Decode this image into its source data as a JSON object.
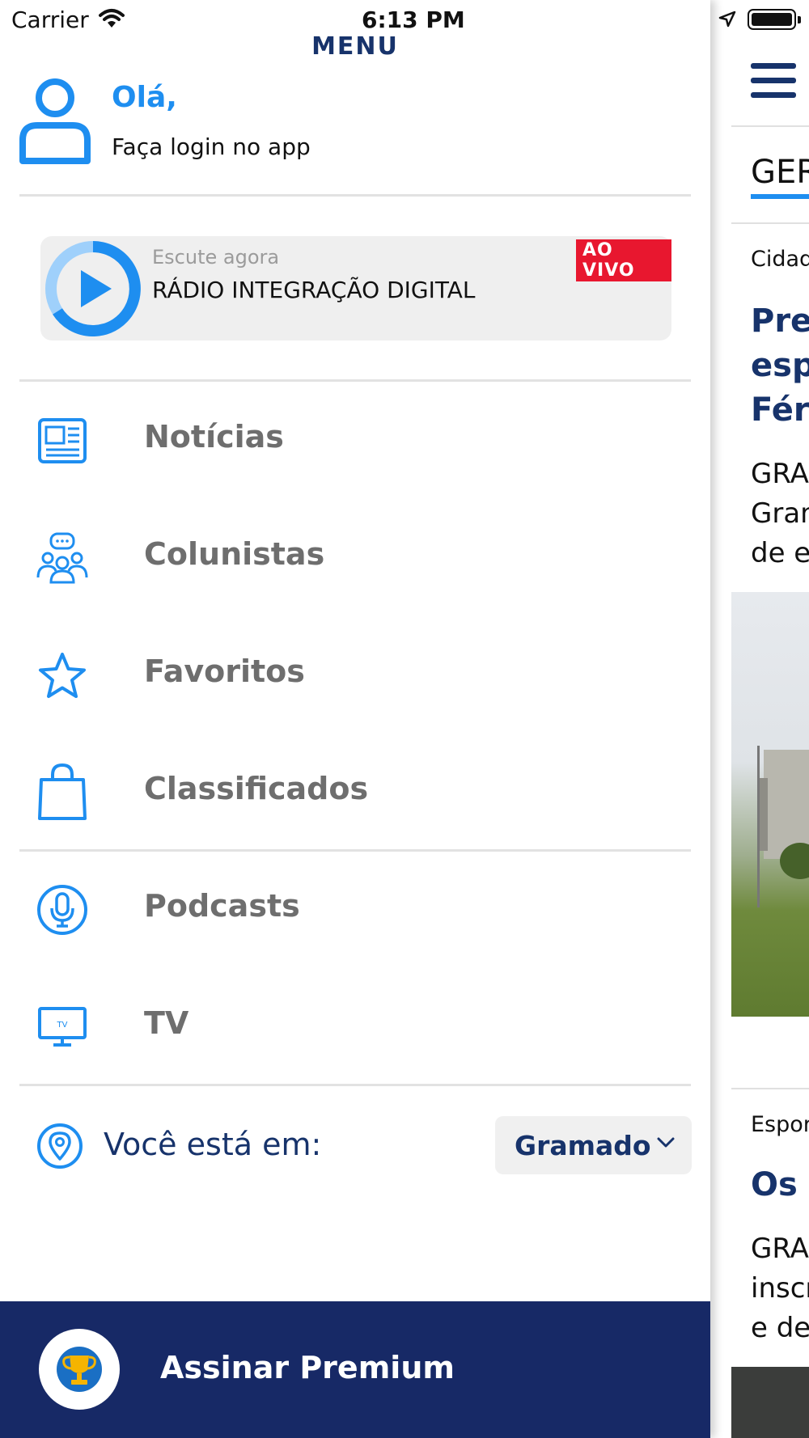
{
  "status_bar": {
    "carrier": "Carrier",
    "time": "6:13 PM"
  },
  "drawer": {
    "title": "MENU",
    "user": {
      "greeting": "Olá,",
      "login_prompt": "Faça login no app"
    },
    "radio": {
      "subtitle": "Escute agora",
      "station": "RÁDIO INTEGRAÇÃO DIGITAL",
      "live_badge": "AO VIVO"
    },
    "items": [
      {
        "label": "Notícias",
        "icon": "newspaper-icon"
      },
      {
        "label": "Colunistas",
        "icon": "columnists-icon"
      },
      {
        "label": "Favoritos",
        "icon": "star-icon"
      },
      {
        "label": "Classificados",
        "icon": "shopping-bag-icon"
      },
      {
        "label": "Podcasts",
        "icon": "microphone-icon"
      },
      {
        "label": "TV",
        "icon": "tv-icon"
      }
    ],
    "location": {
      "label": "Você está em:",
      "city": "Gramado"
    },
    "premium": {
      "label": "Assinar Premium"
    }
  },
  "background_app": {
    "tab": "GER",
    "articles": [
      {
        "category": "Cidad",
        "headline_lines": [
          "Pref",
          "espo",
          "Férr"
        ],
        "body_lines": [
          "GRA",
          "Gran",
          "de e"
        ]
      },
      {
        "category": "Espor",
        "headline_lines": [
          "Os d"
        ],
        "body_lines": [
          "GRA",
          "inscr",
          "e de"
        ]
      }
    ]
  },
  "colors": {
    "accent_blue": "#1e8ef0",
    "navy": "#17336b",
    "premium_bg": "#172966",
    "live_red": "#e8172f",
    "muted_label": "#6e6e6e"
  }
}
